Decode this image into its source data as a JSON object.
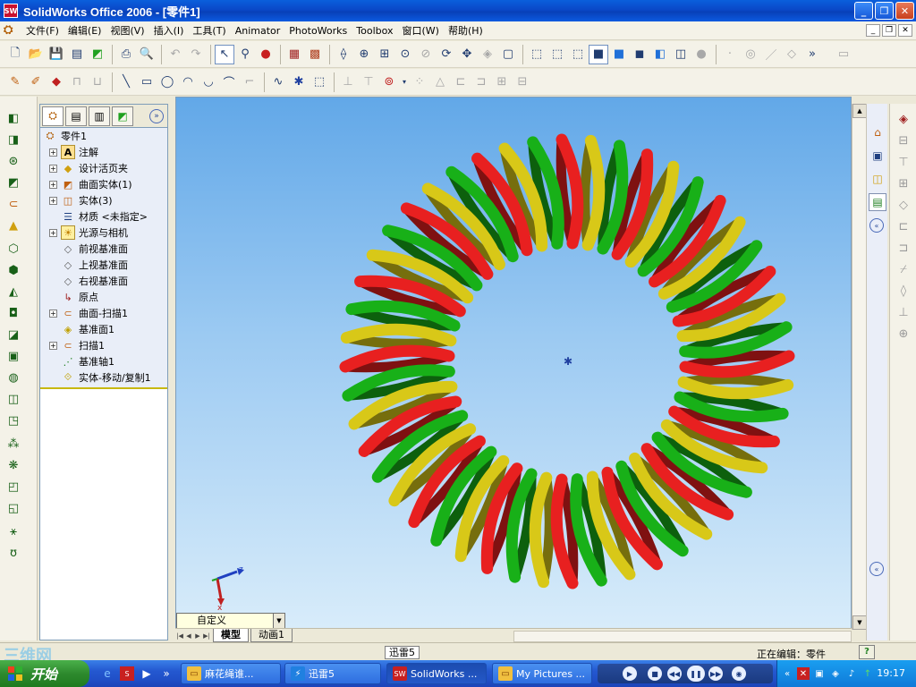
{
  "window": {
    "title": "SolidWorks Office 2006 - [零件1]",
    "app_icon_text": "SW"
  },
  "menu": {
    "items": [
      "文件(F)",
      "编辑(E)",
      "视图(V)",
      "插入(I)",
      "工具(T)",
      "Animator",
      "PhotoWorks",
      "Toolbox",
      "窗口(W)",
      "帮助(H)"
    ]
  },
  "feature_tree": {
    "root": "零件1",
    "items": [
      {
        "label": "注解",
        "expandable": true,
        "icon": "annotation-icon"
      },
      {
        "label": "设计活页夹",
        "expandable": true,
        "icon": "design-binder-icon"
      },
      {
        "label": "曲面实体(1)",
        "expandable": true,
        "icon": "surface-bodies-icon"
      },
      {
        "label": "实体(3)",
        "expandable": true,
        "icon": "solid-bodies-icon"
      },
      {
        "label": "材质 <未指定>",
        "expandable": false,
        "icon": "material-icon"
      },
      {
        "label": "光源与相机",
        "expandable": true,
        "icon": "lights-cameras-icon"
      },
      {
        "label": "前视基准面",
        "expandable": false,
        "icon": "plane-icon"
      },
      {
        "label": "上视基准面",
        "expandable": false,
        "icon": "plane-icon"
      },
      {
        "label": "右视基准面",
        "expandable": false,
        "icon": "plane-icon"
      },
      {
        "label": "原点",
        "expandable": false,
        "icon": "origin-icon"
      },
      {
        "label": "曲面-扫描1",
        "expandable": true,
        "icon": "surface-sweep-icon"
      },
      {
        "label": "基准面1",
        "expandable": false,
        "icon": "plane-icon"
      },
      {
        "label": "扫描1",
        "expandable": true,
        "icon": "sweep-icon"
      },
      {
        "label": "基准轴1",
        "expandable": false,
        "icon": "axis-icon"
      },
      {
        "label": "实体-移动/复制1",
        "expandable": false,
        "icon": "move-copy-icon"
      }
    ]
  },
  "viewport": {
    "view_orientation": "自定义",
    "triad_axes": {
      "z": "z",
      "x": "x"
    },
    "model": {
      "description_colors": [
        "#e82020",
        "#d8c818",
        "#18b018"
      ],
      "coil_count": 48
    }
  },
  "doc_tabs": [
    "模型",
    "动画1"
  ],
  "status": {
    "tooltip": "迅雷5",
    "editing": "正在编辑：零件",
    "help_icon": "?"
  },
  "watermark": "三维网",
  "taskbar": {
    "start_label": "开始",
    "tasks": [
      {
        "label": "麻花绳谁...",
        "icon": "folder-icon"
      },
      {
        "label": "迅雷5",
        "icon": "thunder-icon"
      },
      {
        "label": "SolidWorks ...",
        "icon": "solidworks-icon",
        "active": true
      },
      {
        "label": "My Pictures ...",
        "icon": "folder-icon"
      }
    ],
    "clock": "19:17"
  }
}
